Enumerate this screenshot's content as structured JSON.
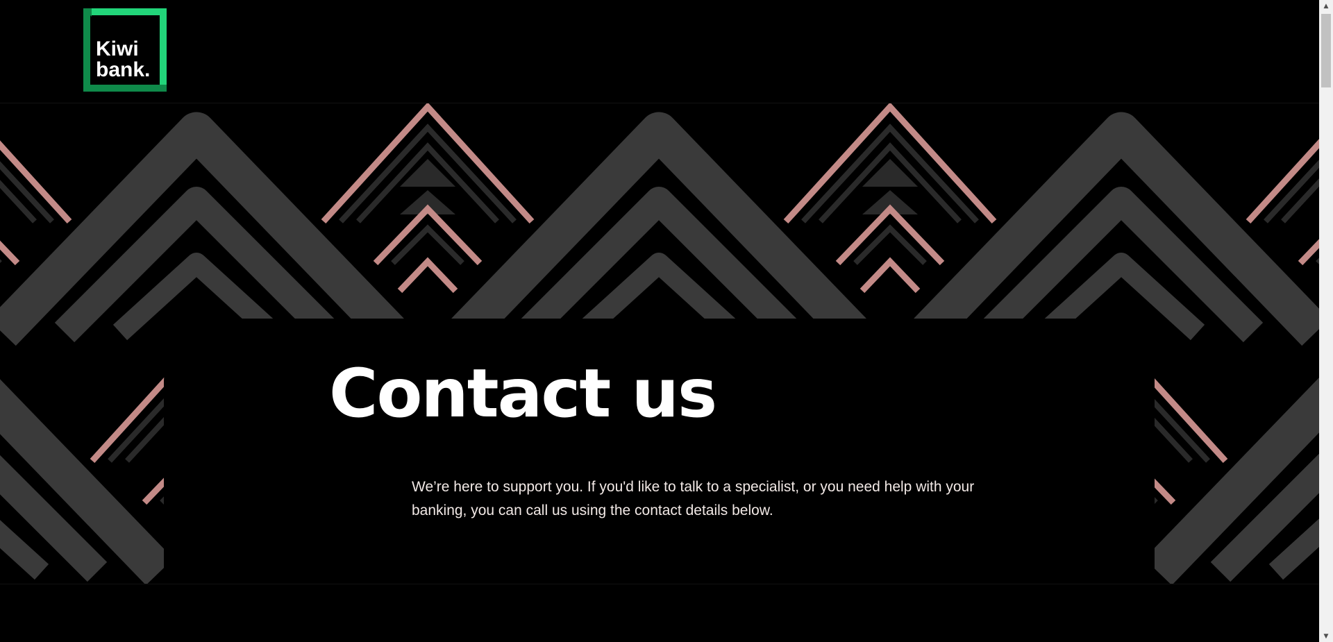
{
  "header": {
    "logo": {
      "line1": "Kiwi",
      "line2": "bank.",
      "icon": "kiwibank-logo",
      "colors": {
        "primary": "#22d57a",
        "secondary": "#0f8a4a"
      }
    }
  },
  "hero": {
    "title": "Contact us",
    "description": "We’re here to support you. If you'd like to talk to a specialist, or you need help with your banking, you can call us using the contact details below.",
    "pattern_colors": {
      "grey": "#3a3a3a",
      "dark_grey": "#2a2a2a",
      "pink": "#c38a87"
    }
  },
  "scrollbar": {
    "up_icon": "chevron-up-icon",
    "down_icon": "chevron-down-icon"
  }
}
